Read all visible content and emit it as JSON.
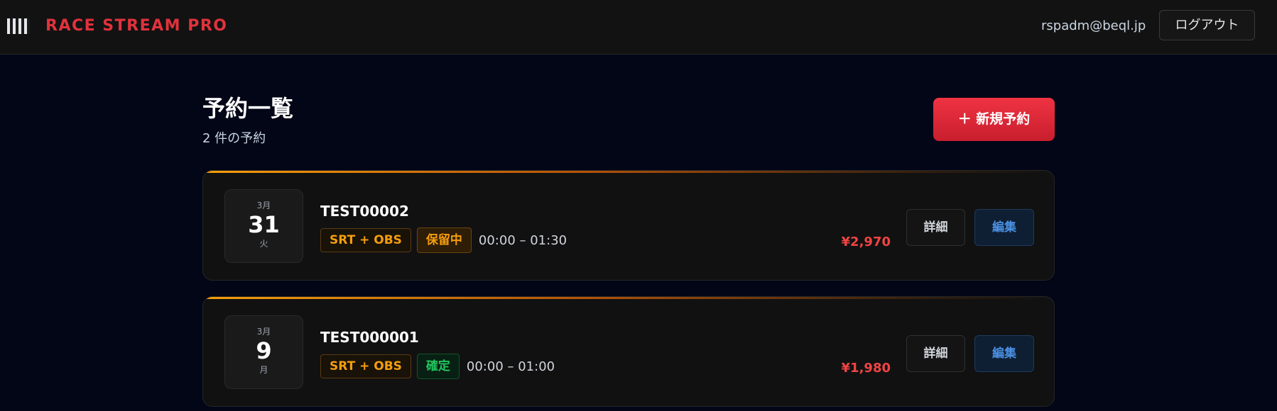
{
  "header": {
    "brand": "RACE STREAM PRO",
    "user_email": "rspadm@beql.jp",
    "logout_label": "ログアウト"
  },
  "main": {
    "title": "予約一覧",
    "subtitle": "2 件の予約",
    "new_button_label": "＋ 新規予約"
  },
  "reservations": [
    {
      "month": "3月",
      "day": "31",
      "weekday": "火",
      "id": "TEST00002",
      "plan": "SRT + OBS",
      "status": "保留中",
      "time": "00:00 – 01:30",
      "price": "¥2,970",
      "detail_label": "詳細",
      "edit_label": "編集"
    },
    {
      "month": "3月",
      "day": "9",
      "weekday": "月",
      "id": "TEST000001",
      "plan": "SRT + OBS",
      "status": "確定",
      "time": "00:00 – 01:00",
      "price": "¥1,980",
      "detail_label": "詳細",
      "edit_label": "編集"
    }
  ],
  "colors": {
    "brand": "#e1323c",
    "accent": "#f59e0b",
    "background": "#020617",
    "status_pending": "#f59e0b",
    "status_confirmed": "#22c55e",
    "price": "#ef4444",
    "edit": "#4a90e2"
  },
  "icons": {
    "brand": "checkered-flag-icon"
  }
}
